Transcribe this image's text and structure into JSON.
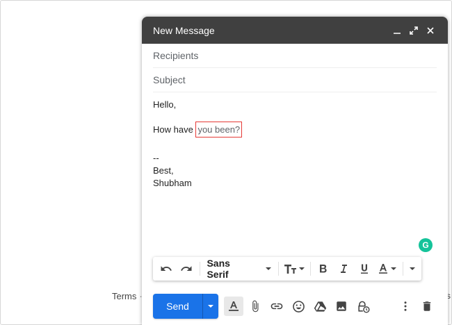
{
  "background": {
    "terms": "Terms",
    "terms_sep": "·",
    "right_fragment": "s"
  },
  "compose": {
    "title": "New Message",
    "recipients_placeholder": "Recipients",
    "subject_placeholder": "Subject",
    "body": {
      "greeting": "Hello,",
      "line_prefix": "How have",
      "line_highlight": "you been?",
      "sig_dash": "--",
      "sig_closing": "Best,",
      "sig_name": "Shubham"
    },
    "grammarly_letter": "G",
    "format_toolbar": {
      "font": "Sans Serif"
    },
    "send_label": "Send"
  },
  "colors": {
    "titlebar": "#404040",
    "send": "#1a73e8",
    "grammarly": "#15c39a",
    "highlight_border": "#e53935"
  }
}
